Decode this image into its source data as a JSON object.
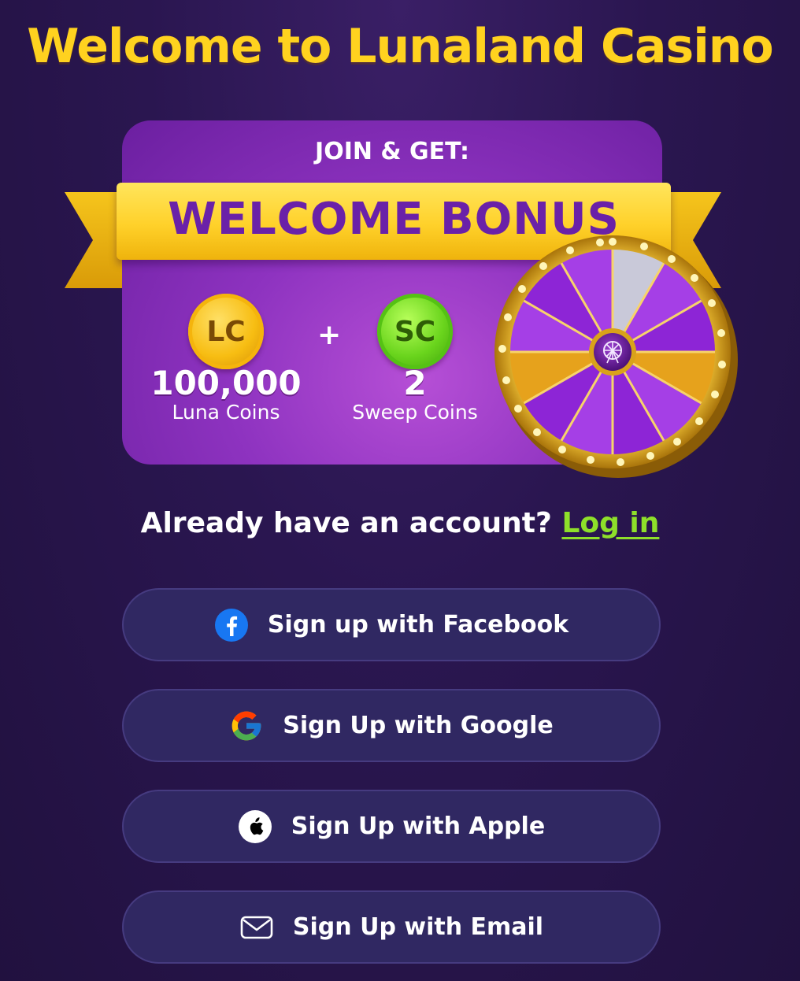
{
  "page": {
    "title": "Welcome to Lunaland Casino"
  },
  "bonus": {
    "join_label": "JOIN & GET:",
    "ribbon_text": "WELCOME BONUS",
    "plus": "+",
    "coins": [
      {
        "icon_text": "LC",
        "amount": "100,000",
        "label": "Luna Coins",
        "icon": "luna-coin-icon",
        "color": "#f7bd12"
      },
      {
        "icon_text": "SC",
        "amount": "2",
        "label": "Sweep Coins",
        "icon": "sweep-coin-icon",
        "color": "#69d41c"
      }
    ],
    "wheel_icon": "prize-wheel-icon"
  },
  "account": {
    "prompt": "Already have an account?",
    "login_label": "Log in"
  },
  "signup": [
    {
      "label": "Sign up with Facebook",
      "icon": "facebook-icon"
    },
    {
      "label": "Sign Up with Google",
      "icon": "google-icon"
    },
    {
      "label": "Sign Up with Apple",
      "icon": "apple-icon"
    },
    {
      "label": "Sign Up with Email",
      "icon": "email-icon"
    }
  ],
  "colors": {
    "title": "#ffd21f",
    "link": "#8ee02a",
    "button_bg": "#302862",
    "background": "#2a1650"
  }
}
